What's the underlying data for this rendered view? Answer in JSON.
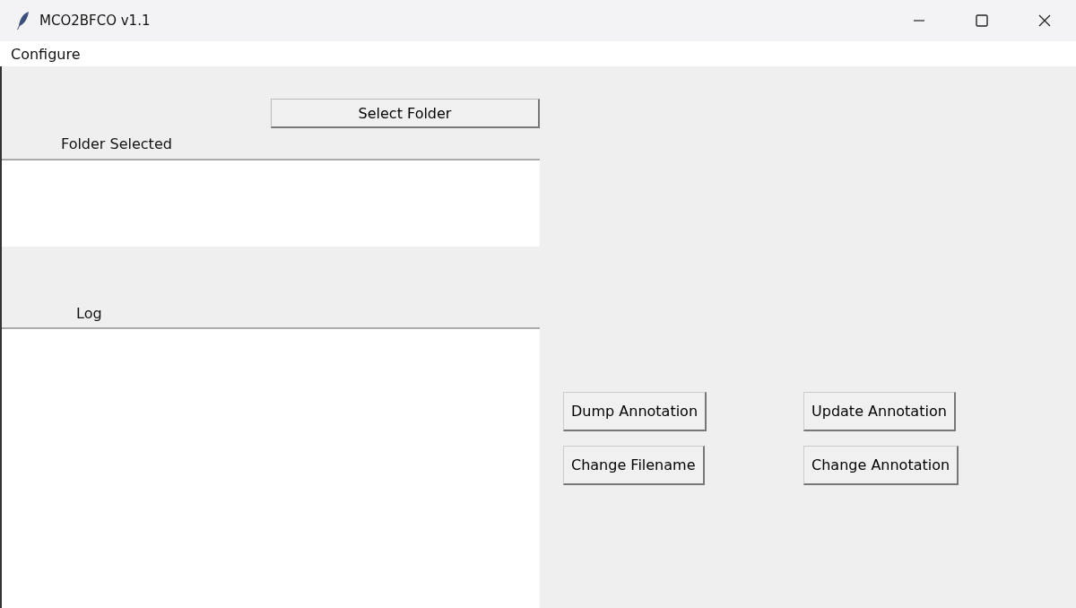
{
  "window": {
    "title": "MCO2BFCO v1.1"
  },
  "menu": [
    "Configure"
  ],
  "select_folder_button": "Select Folder",
  "folder_selected": {
    "label": "Folder Selected"
  },
  "log": {
    "label": "Log"
  },
  "actions": [
    [
      "Dump Annotation",
      "Update Annotation"
    ],
    [
      "Change Filename",
      "Change Annotation"
    ]
  ]
}
